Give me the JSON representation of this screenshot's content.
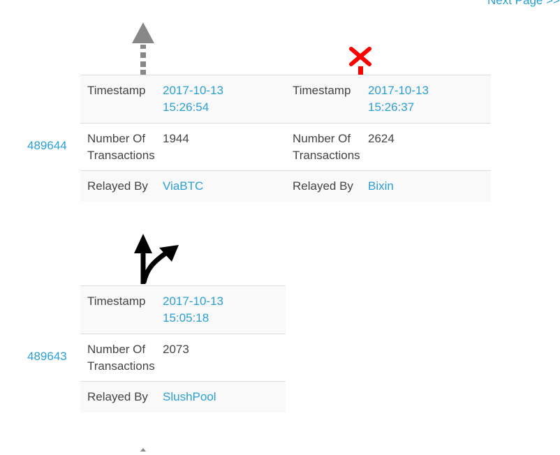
{
  "pagination": {
    "next_label": "Next Page >>"
  },
  "labels": {
    "timestamp": "Timestamp",
    "num_tx_line1": "Number Of",
    "num_tx_line2": "Transactions",
    "relayed_by": "Relayed By"
  },
  "blocks": [
    {
      "height": "489644",
      "branches": [
        {
          "icon": "gray-dashed-up-arrow-icon",
          "timestamp_date": "2017-10-13",
          "timestamp_time": "15:26:54",
          "transactions": "1944",
          "relayed_by": "ViaBTC"
        },
        {
          "icon": "red-cross-icon",
          "timestamp_date": "2017-10-13",
          "timestamp_time": "15:26:37",
          "transactions": "2624",
          "relayed_by": "Bixin"
        }
      ]
    },
    {
      "height": "489643",
      "branches": [
        {
          "icon": "black-fork-arrow-icon",
          "timestamp_date": "2017-10-13",
          "timestamp_time": "15:05:18",
          "transactions": "2073",
          "relayed_by": "SlushPool"
        }
      ]
    }
  ],
  "colors": {
    "link": "#2a9fd6",
    "text": "#444444",
    "row_shade": "#f9f9f9",
    "border": "#dddddd",
    "gray_arrow": "#888888",
    "red_cross": "#ff0000",
    "black_arrow": "#000000"
  }
}
